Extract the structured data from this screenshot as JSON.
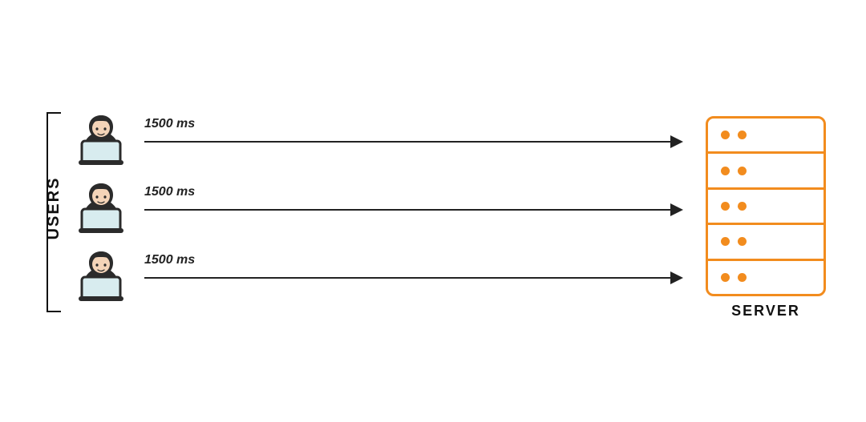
{
  "labels": {
    "users": "USERS",
    "server": "SERVER"
  },
  "users": [
    {
      "latency": "1500 ms"
    },
    {
      "latency": "1500 ms"
    },
    {
      "latency": "1500 ms"
    }
  ],
  "server": {
    "units": 5,
    "dots_per_unit": 2,
    "accent": "#f28c1e"
  }
}
